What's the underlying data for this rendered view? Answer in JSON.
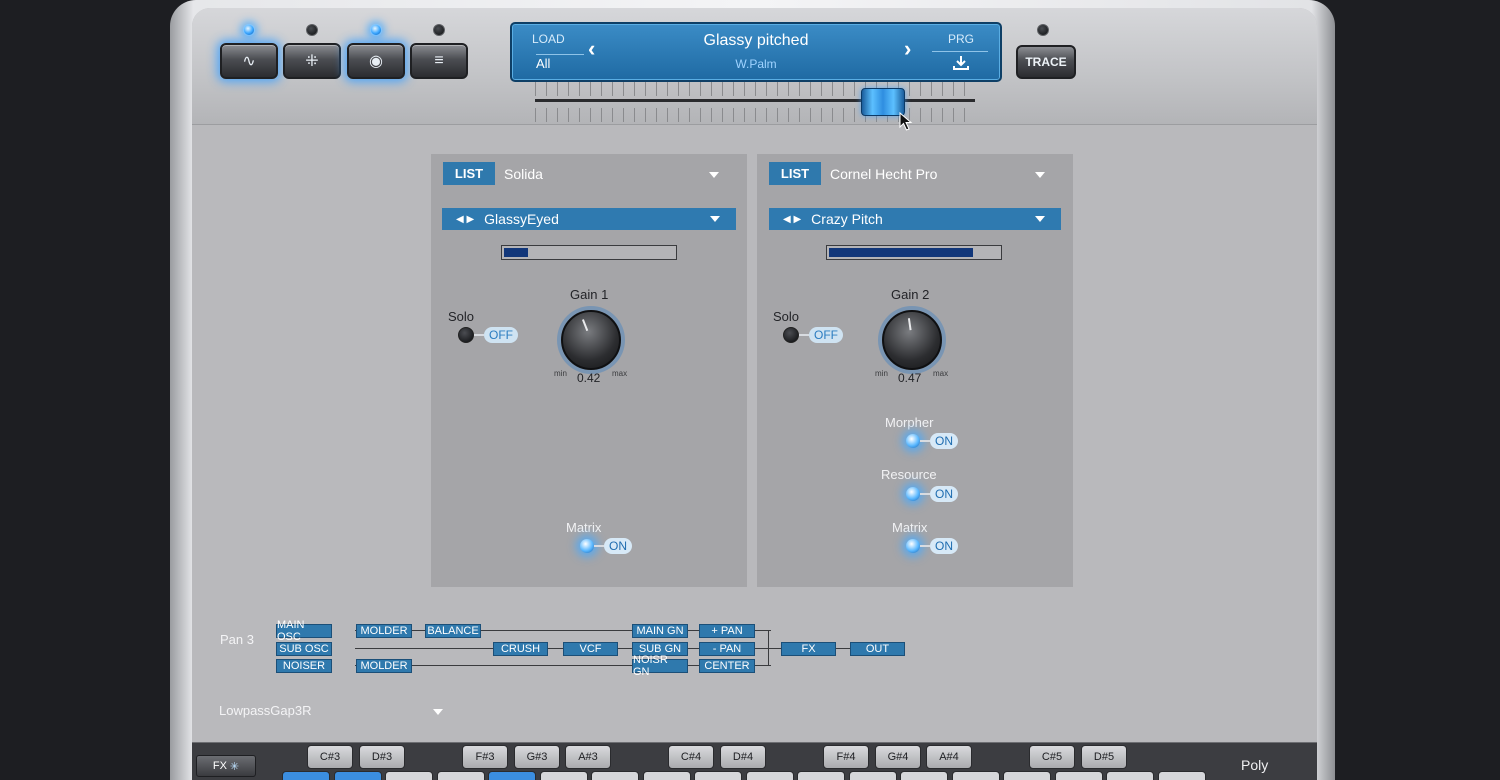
{
  "toolbar": {
    "mode_buttons": [
      {
        "icon": "sine-wave-icon",
        "glyph": "∿",
        "led_on": true,
        "active": true
      },
      {
        "icon": "grid-dots-icon",
        "glyph": "⁜",
        "led_on": false,
        "active": false
      },
      {
        "icon": "circle-target-icon",
        "glyph": "◉",
        "led_on": true,
        "active": true
      },
      {
        "icon": "menu-lines-icon",
        "glyph": "≡",
        "led_on": false,
        "active": false
      }
    ],
    "trace_label": "TRACE"
  },
  "preset": {
    "load_label": "LOAD",
    "load_value": "All",
    "name": "Glassy pitched",
    "author": "W.Palm",
    "prg_label": "PRG"
  },
  "morph_slider": {
    "value": 0.82
  },
  "panels": [
    {
      "list_label": "LIST",
      "font_name": "Solida",
      "preset_name": "GlassyEyed",
      "level": 0.16,
      "gain_label": "Gain 1",
      "gain_value": "0.42",
      "min_label": "min",
      "max_label": "max",
      "solo_label": "Solo",
      "solo_state": "OFF",
      "matrix_label": "Matrix",
      "matrix_state": "ON"
    },
    {
      "list_label": "LIST",
      "font_name": "Cornel Hecht Pro",
      "preset_name": "Crazy Pitch",
      "level": 0.85,
      "gain_label": "Gain 2",
      "gain_value": "0.47",
      "min_label": "min",
      "max_label": "max",
      "solo_label": "Solo",
      "solo_state": "OFF",
      "morpher_label": "Morpher",
      "morpher_state": "ON",
      "resource_label": "Resource",
      "resource_state": "ON",
      "matrix_label": "Matrix",
      "matrix_state": "ON"
    }
  ],
  "routing": {
    "pan_label": "Pan 3",
    "nodes": {
      "main_osc": "MAIN OSC",
      "sub_osc": "SUB OSC",
      "noiser": "NOISER",
      "molder1": "MOLDER",
      "molder2": "MOLDER",
      "balance": "BALANCE",
      "crush": "CRUSH",
      "vcf": "VCF",
      "main_gn": "MAIN GN",
      "sub_gn": "SUB GN",
      "noisr_gn": "NOISR GN",
      "plus_pan": "+ PAN",
      "minus_pan": "- PAN",
      "center": "CENTER",
      "fx": "FX",
      "out": "OUT"
    },
    "filter_name": "LowpassGap3R"
  },
  "keyboard": {
    "fx_label": "FX",
    "mode_label": "Poly",
    "black_keys": [
      "C#3",
      "D#3",
      "F#3",
      "G#3",
      "A#3",
      "C#4",
      "D#4",
      "F#4",
      "G#4",
      "A#4",
      "C#5",
      "D#5"
    ]
  },
  "colors": {
    "accent_blue": "#2f79ad",
    "led_glow": "#39a6ff",
    "panel_bg": "#a5a5a8",
    "meter_fill": "#12377a"
  }
}
